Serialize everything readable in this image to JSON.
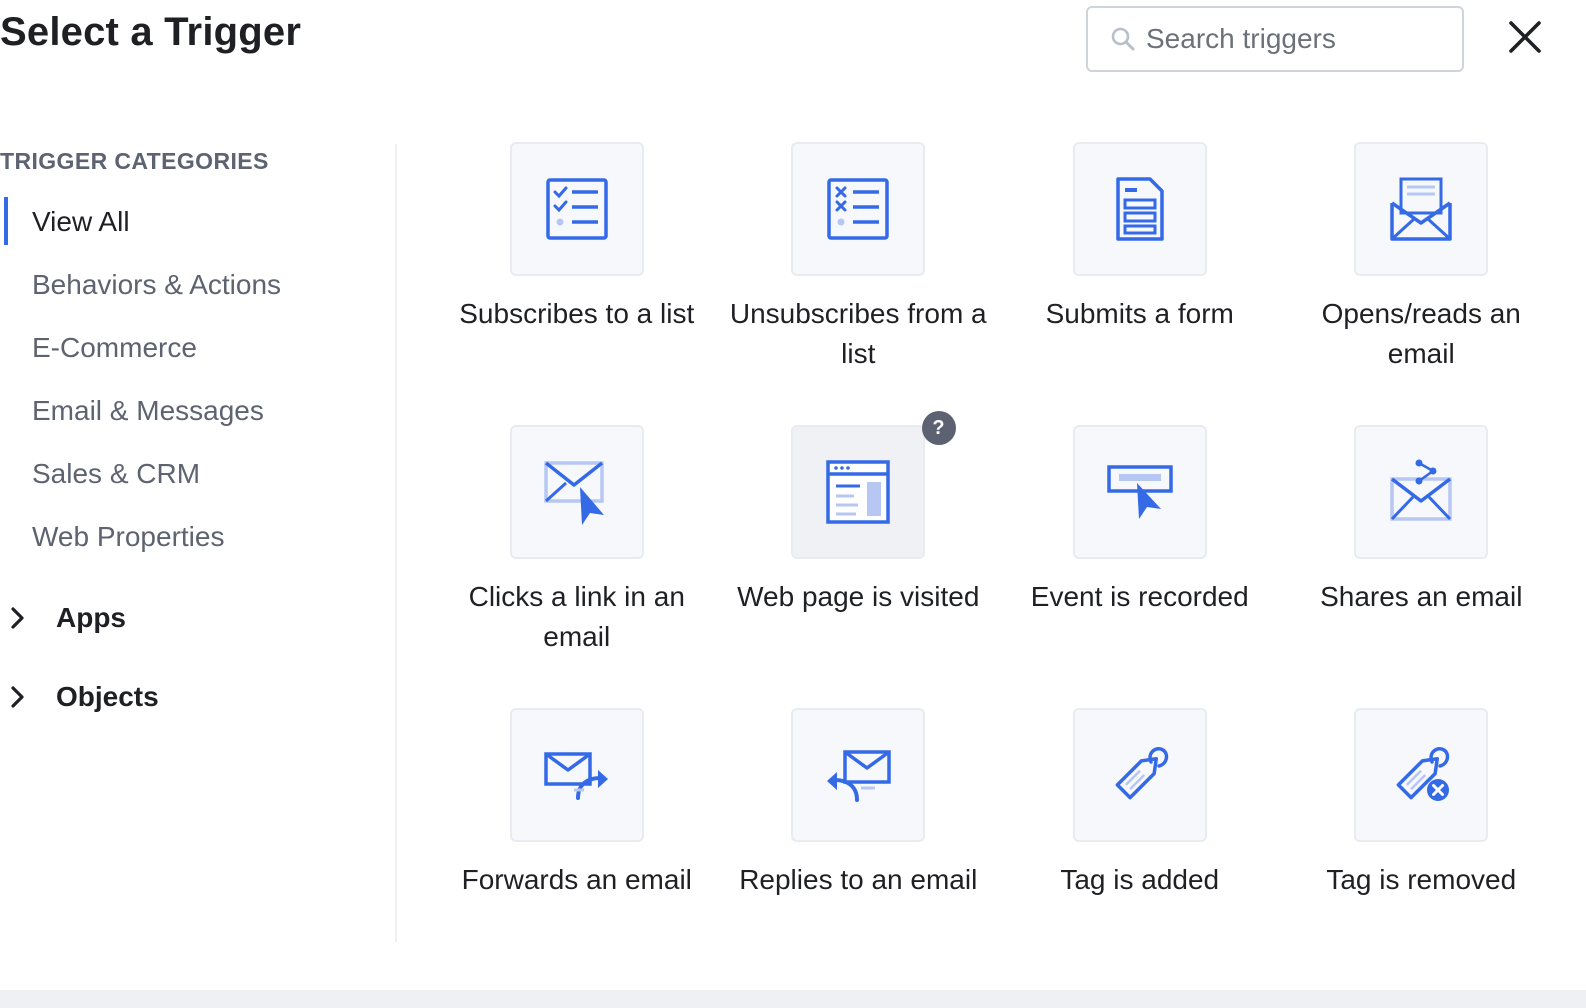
{
  "header": {
    "title": "Select a Trigger",
    "search_placeholder": "Search triggers",
    "search_icon": "search-icon",
    "close_icon": "close-icon"
  },
  "sidebar": {
    "heading": "TRIGGER CATEGORIES",
    "categories": [
      {
        "label": "View All",
        "active": true
      },
      {
        "label": "Behaviors & Actions",
        "active": false
      },
      {
        "label": "E-Commerce",
        "active": false
      },
      {
        "label": "Email & Messages",
        "active": false
      },
      {
        "label": "Sales & CRM",
        "active": false
      },
      {
        "label": "Web Properties",
        "active": false
      }
    ],
    "groups": [
      {
        "label": "Apps",
        "icon": "chevron-right-icon"
      },
      {
        "label": "Objects",
        "icon": "chevron-right-icon"
      }
    ]
  },
  "triggers": [
    {
      "label": "Subscribes to a list",
      "icon": "checklist-icon"
    },
    {
      "label": "Unsubscribes from a list",
      "icon": "unsubscribe-list-icon"
    },
    {
      "label": "Submits a form",
      "icon": "form-icon"
    },
    {
      "label": "Opens/reads an email",
      "icon": "open-email-icon"
    },
    {
      "label": "Clicks a link in an email",
      "icon": "email-click-icon"
    },
    {
      "label": "Web page is visited",
      "icon": "web-page-icon",
      "help_badge": "?"
    },
    {
      "label": "Event is recorded",
      "icon": "event-icon"
    },
    {
      "label": "Shares an email",
      "icon": "share-email-icon"
    },
    {
      "label": "Forwards an email",
      "icon": "forward-email-icon"
    },
    {
      "label": "Replies to an email",
      "icon": "reply-email-icon"
    },
    {
      "label": "Tag is added",
      "icon": "tag-add-icon"
    },
    {
      "label": "Tag is removed",
      "icon": "tag-remove-icon"
    }
  ],
  "colors": {
    "accent": "#356ae6",
    "icon_light": "#b7c7f3",
    "muted_text": "#5d6370"
  }
}
